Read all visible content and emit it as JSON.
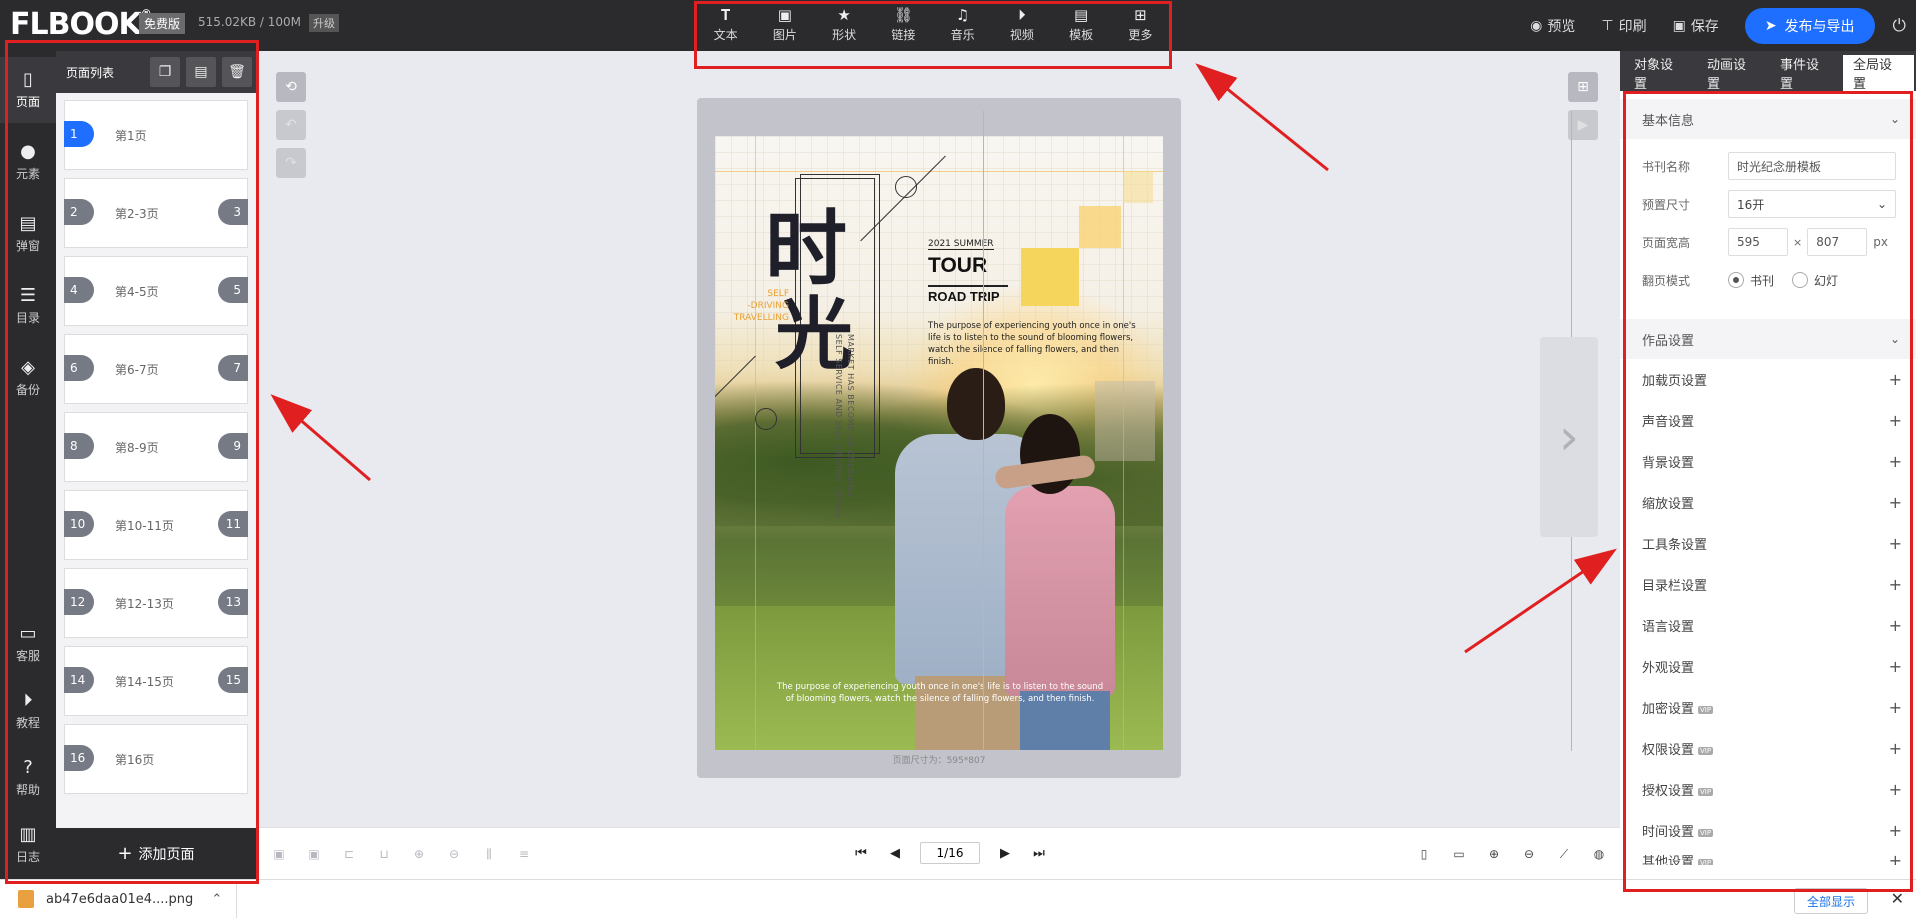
{
  "app": {
    "logo": "FLBOOK",
    "plan_badge": "免费版",
    "storage": "515.02KB / 100M",
    "upgrade_badge": "升级"
  },
  "toolbar": [
    {
      "name": "text",
      "label": "文本",
      "icon": "text-icon"
    },
    {
      "name": "image",
      "label": "图片",
      "icon": "image-icon"
    },
    {
      "name": "shape",
      "label": "形状",
      "icon": "star-icon"
    },
    {
      "name": "link",
      "label": "链接",
      "icon": "link-icon"
    },
    {
      "name": "music",
      "label": "音乐",
      "icon": "music-icon"
    },
    {
      "name": "video",
      "label": "视频",
      "icon": "play-circle-icon"
    },
    {
      "name": "template",
      "label": "模板",
      "icon": "template-icon"
    },
    {
      "name": "more",
      "label": "更多",
      "icon": "grid-plus-icon"
    }
  ],
  "top_actions": {
    "preview": "预览",
    "print": "印刷",
    "save": "保存",
    "publish": "发布与导出"
  },
  "left_nav": [
    {
      "name": "page",
      "label": "页面",
      "icon": "page-icon",
      "active": true
    },
    {
      "name": "element",
      "label": "元素",
      "icon": "shapes-icon"
    },
    {
      "name": "popup",
      "label": "弹窗",
      "icon": "popup-icon"
    },
    {
      "name": "toc",
      "label": "目录",
      "icon": "list-icon"
    },
    {
      "name": "backup",
      "label": "备份",
      "icon": "layers-icon"
    },
    {
      "name": "support",
      "label": "客服",
      "icon": "chat-icon"
    },
    {
      "name": "tutorial",
      "label": "教程",
      "icon": "play-circle-icon"
    },
    {
      "name": "help",
      "label": "帮助",
      "icon": "question-icon"
    },
    {
      "name": "log",
      "label": "日志",
      "icon": "log-icon"
    }
  ],
  "page_panel": {
    "title": "页面列表",
    "add_page": "添加页面",
    "pages": [
      {
        "label": "第1页",
        "left": "1",
        "right": "",
        "active": true
      },
      {
        "label": "第2-3页",
        "left": "2",
        "right": "3"
      },
      {
        "label": "第4-5页",
        "left": "4",
        "right": "5"
      },
      {
        "label": "第6-7页",
        "left": "6",
        "right": "7"
      },
      {
        "label": "第8-9页",
        "left": "8",
        "right": "9"
      },
      {
        "label": "第10-11页",
        "left": "10",
        "right": "11"
      },
      {
        "label": "第12-13页",
        "left": "12",
        "right": "13"
      },
      {
        "label": "第14-15页",
        "left": "14",
        "right": "15"
      },
      {
        "label": "第16页",
        "left": "16",
        "right": ""
      }
    ]
  },
  "poster": {
    "calligraphy_1": "时",
    "calligraphy_2": "光",
    "travelling": "SELF\n-DRIVING\nTRAVELLING",
    "vertical_1": "SELF SERVICE AND SELF DRIVING TRAVEL",
    "vertical_2": "MARKET HAS BECOME AN EMERGING",
    "summer": "2021 SUMMER",
    "tour": "TOUR",
    "road_trip": "ROAD TRIP",
    "paragraph_top": "The purpose of experiencing youth once in one's life is to listen to the sound of blooming flowers, watch the silence of falling flowers, and then finish.",
    "paragraph_bottom": "The purpose of experiencing youth once in one's life is to listen to the sound of blooming flowers, watch the silence of falling flowers, and then finish.",
    "page_size_note": "页面尺寸为：595*807"
  },
  "pager": {
    "current": "1/16"
  },
  "right_panel": {
    "tabs": [
      {
        "label": "对象设置"
      },
      {
        "label": "动画设置"
      },
      {
        "label": "事件设置"
      },
      {
        "label": "全局设置",
        "active": true
      }
    ],
    "basic_info": {
      "title": "基本信息",
      "book_name_label": "书刊名称",
      "book_name_value": "时光纪念册模板",
      "preset_size_label": "预置尺寸",
      "preset_size_value": "16开",
      "page_size_label": "页面宽高",
      "page_width": "595",
      "page_height": "807",
      "times": "×",
      "unit": "px",
      "flip_mode_label": "翻页模式",
      "flip_book": "书刊",
      "flip_slide": "幻灯"
    },
    "work_settings": {
      "title": "作品设置",
      "items": [
        {
          "label": "加载页设置",
          "vip": false
        },
        {
          "label": "声音设置",
          "vip": false
        },
        {
          "label": "背景设置",
          "vip": false
        },
        {
          "label": "缩放设置",
          "vip": false
        },
        {
          "label": "工具条设置",
          "vip": false
        },
        {
          "label": "目录栏设置",
          "vip": false
        },
        {
          "label": "语言设置",
          "vip": false
        },
        {
          "label": "外观设置",
          "vip": false
        },
        {
          "label": "加密设置",
          "vip": true
        },
        {
          "label": "权限设置",
          "vip": true
        },
        {
          "label": "授权设置",
          "vip": true
        },
        {
          "label": "时间设置",
          "vip": true
        },
        {
          "label": "其他设置",
          "vip": true
        }
      ],
      "vip_label": "VIP"
    }
  },
  "download_bar": {
    "filename": "ab47e6daa01e4....png",
    "show_all": "全部显示"
  },
  "colors": {
    "dark": "#2b2b2e",
    "accent": "#1e6fff",
    "annotation": "#e02020",
    "guide": "#f0b040"
  }
}
